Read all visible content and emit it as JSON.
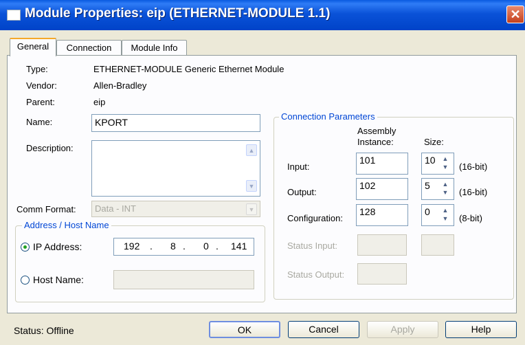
{
  "window": {
    "title": "Module Properties: eip (ETHERNET-MODULE 1.1)",
    "close_glyph": "✕"
  },
  "tabs": [
    {
      "label": "General",
      "active": true
    },
    {
      "label": "Connection",
      "active": false
    },
    {
      "label": "Module Info",
      "active": false
    }
  ],
  "general": {
    "type_label": "Type:",
    "type_value": "ETHERNET-MODULE Generic Ethernet Module",
    "vendor_label": "Vendor:",
    "vendor_value": "Allen-Bradley",
    "parent_label": "Parent:",
    "parent_value": "eip",
    "name_label": "Name:",
    "name_value": "KPORT",
    "description_label": "Description:",
    "description_value": "",
    "comm_format_label": "Comm Format:",
    "comm_format_value": "Data - INT"
  },
  "address": {
    "group_title": "Address / Host Name",
    "ip_label": "IP Address:",
    "ip_selected": true,
    "ip_octets": [
      "192",
      "8",
      "0",
      "141"
    ],
    "host_label": "Host Name:",
    "host_selected": false,
    "host_value": ""
  },
  "connection_parameters": {
    "group_title": "Connection Parameters",
    "col_instance_line1": "Assembly",
    "col_instance_line2": "Instance:",
    "col_size": "Size:",
    "rows": [
      {
        "label": "Input:",
        "instance": "101",
        "size": "10",
        "unit": "(16-bit)"
      },
      {
        "label": "Output:",
        "instance": "102",
        "size": "5",
        "unit": "(16-bit)"
      },
      {
        "label": "Configuration:",
        "instance": "128",
        "size": "0",
        "unit": "(8-bit)"
      }
    ],
    "status_input_label": "Status Input:",
    "status_output_label": "Status Output:"
  },
  "status": {
    "text": "Status:  Offline"
  },
  "buttons": {
    "ok": "OK",
    "cancel": "Cancel",
    "apply": "Apply",
    "help": "Help"
  },
  "colors": {
    "title_bar": "#0a52d8",
    "group_title": "#0046d5",
    "active_tab_accent": "#f5a829"
  }
}
